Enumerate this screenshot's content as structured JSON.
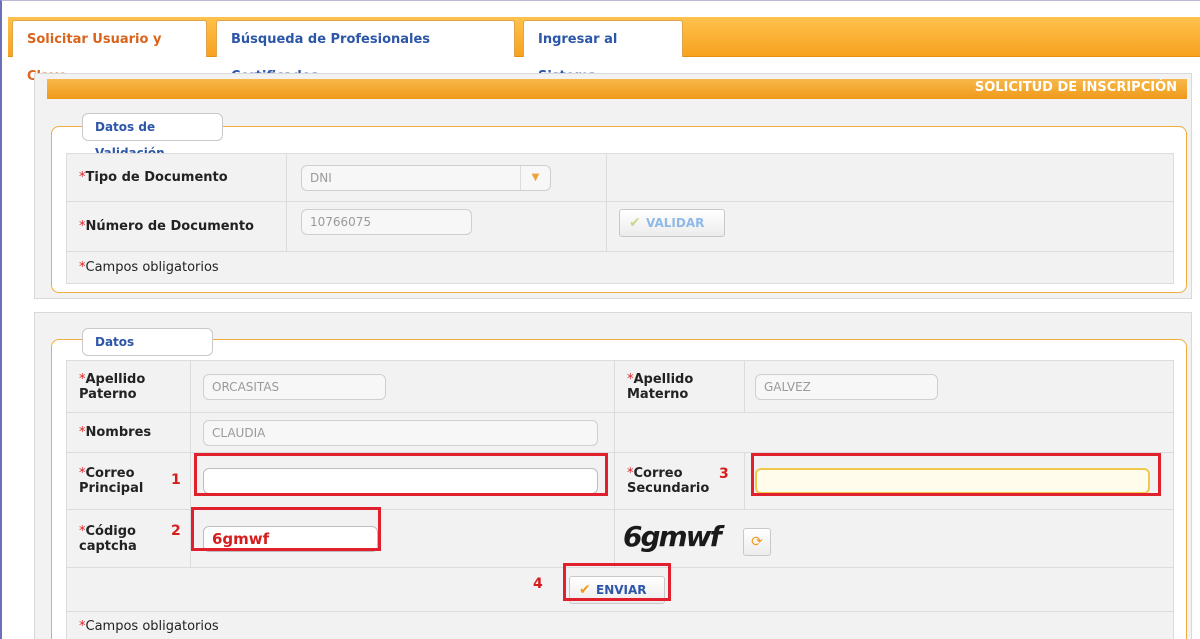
{
  "tabs": [
    {
      "label": "Solicitar Usuario y Clave",
      "active": true
    },
    {
      "label": "Búsqueda de Profesionales Certificados",
      "active": false
    },
    {
      "label": "Ingresar al Sistema",
      "active": false
    }
  ],
  "header": {
    "title": "SOLICITUD DE INSCRIPCIÓN"
  },
  "validation": {
    "legend": "Datos de Validación",
    "doc_type_label": "Tipo de Documento",
    "doc_type_value": "DNI",
    "doc_number_label": "Número de Documento",
    "doc_number_value": "10766075",
    "validate_button": "VALIDAR",
    "required_note": "Campos obligatorios"
  },
  "principal": {
    "legend": "Datos Principales",
    "apellido_paterno_label_1": "Apellido",
    "apellido_paterno_label_2": "Paterno",
    "apellido_paterno_value": "ORCASITAS",
    "apellido_materno_label_1": "Apellido",
    "apellido_materno_label_2": "Materno",
    "apellido_materno_value": "GALVEZ",
    "nombres_label": "Nombres",
    "nombres_value": "CLAUDIA",
    "correo_principal_label_1": "Correo",
    "correo_principal_label_2": "Principal",
    "correo_principal_value": "",
    "correo_secundario_label_1": "Correo",
    "correo_secundario_label_2": "Secundario",
    "correo_secundario_value": "",
    "captcha_label_1": "Código",
    "captcha_label_2": "captcha",
    "captcha_value": "6gmwf",
    "captcha_image_text": "6gmwf",
    "send_button": "ENVIAR",
    "required_note": "Campos obligatorios"
  },
  "markers": [
    "1",
    "2",
    "3",
    "4"
  ],
  "required_mark": "*",
  "icons": {
    "check": "check-icon",
    "refresh": "refresh-icon",
    "dropdown": "chevron-down-icon"
  },
  "colors": {
    "accent": "#f7a21f",
    "link": "#2c56a8",
    "active_tab": "#d9631b",
    "highlight": "#e1202d"
  }
}
